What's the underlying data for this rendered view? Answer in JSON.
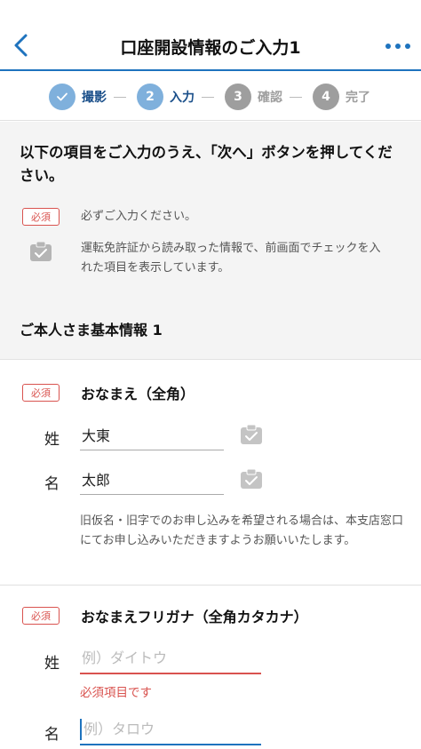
{
  "header": {
    "title": "口座開設情報のご入力1"
  },
  "stepper": {
    "steps": [
      {
        "number": "",
        "label": "撮影",
        "state": "done"
      },
      {
        "number": "2",
        "label": "入力",
        "state": "active"
      },
      {
        "number": "3",
        "label": "確認",
        "state": "pending"
      },
      {
        "number": "4",
        "label": "完了",
        "state": "pending"
      }
    ],
    "colors": {
      "active": "#7fb0dc",
      "pending": "#9e9e9e",
      "active_label": "#1a4f8a",
      "pending_label": "#9e9e9e"
    }
  },
  "intro": {
    "instruction": "以下の項目をご入力のうえ、「次へ」ボタンを押してください。",
    "required_badge": "必須",
    "required_legend": "必ずご入力ください。",
    "ocr_legend": "運転免許証から読み取った情報で、前画面でチェックを入れた項目を表示しています。",
    "section_title": "ご本人さま基本情報 1"
  },
  "name_field": {
    "badge": "必須",
    "title": "おなまえ（全角）",
    "last_label": "姓",
    "last_value": "大東",
    "first_label": "名",
    "first_value": "太郎",
    "note": "旧仮名・旧字でのお申し込みを希望される場合は、本支店窓口にてお申し込みいただきますようお願いいたします。"
  },
  "kana_field": {
    "badge": "必須",
    "title": "おなまえフリガナ（全角カタカナ）",
    "last_label": "姓",
    "last_placeholder": "例）ダイトウ",
    "last_error": "必須項目です",
    "first_label": "名",
    "first_placeholder": "例）タロウ"
  },
  "colors": {
    "accent": "#1e73be",
    "error": "#d9534f",
    "intro_bg": "#f4f4f4"
  }
}
